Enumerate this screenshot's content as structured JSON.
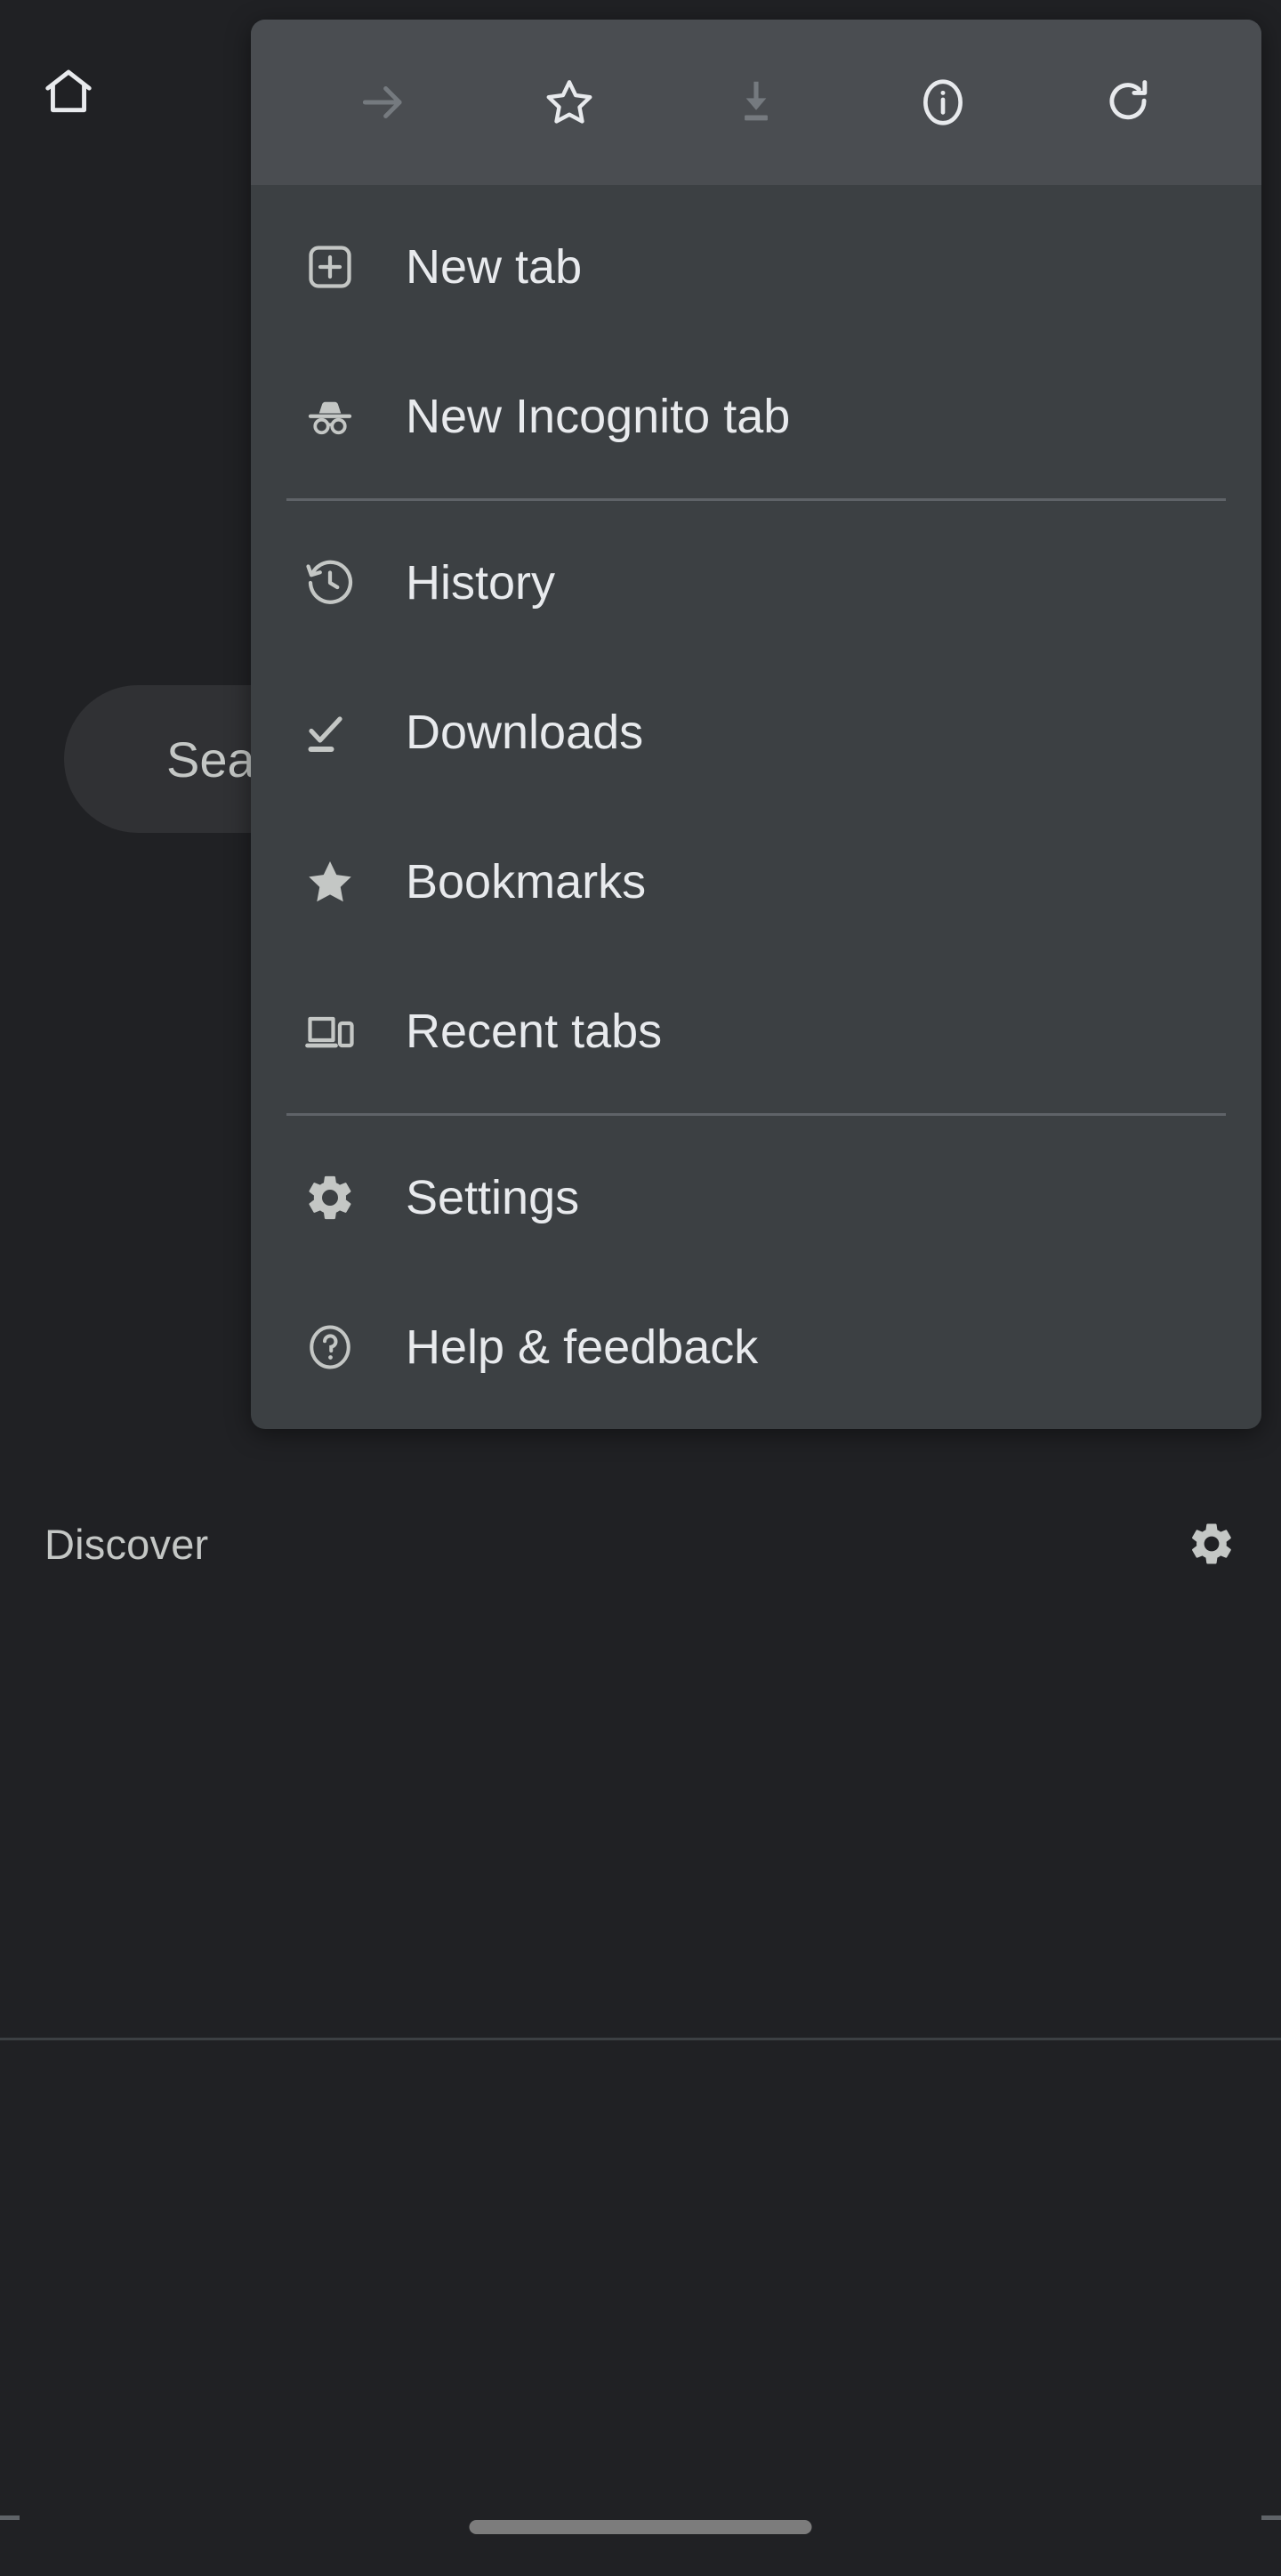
{
  "ntp": {
    "home_icon": "home-icon",
    "logo": "google-g-logo",
    "omnibox": {
      "placeholder": "Search or type web address",
      "visible_text": "Search or type "
    },
    "discover": {
      "label": "Discover",
      "settings_icon": "gear-icon"
    }
  },
  "menu": {
    "icon_row": [
      {
        "name": "forward-arrow-icon",
        "label": "Forward",
        "enabled": false
      },
      {
        "name": "star-outline-icon",
        "label": "Bookmark",
        "enabled": true
      },
      {
        "name": "download-icon",
        "label": "Download page",
        "enabled": false
      },
      {
        "name": "info-circle-icon",
        "label": "Page info",
        "enabled": true
      },
      {
        "name": "reload-icon",
        "label": "Reload",
        "enabled": true
      }
    ],
    "groups": [
      {
        "items": [
          {
            "icon": "new-tab-icon",
            "label": "New tab"
          },
          {
            "icon": "incognito-icon",
            "label": "New Incognito tab"
          }
        ]
      },
      {
        "items": [
          {
            "icon": "history-icon",
            "label": "History"
          },
          {
            "icon": "downloads-icon",
            "label": "Downloads"
          },
          {
            "icon": "star-filled-icon",
            "label": "Bookmarks"
          },
          {
            "icon": "recent-tabs-icon",
            "label": "Recent tabs"
          }
        ]
      },
      {
        "items": [
          {
            "icon": "gear-icon",
            "label": "Settings"
          },
          {
            "icon": "help-circle-icon",
            "label": "Help & feedback"
          }
        ]
      }
    ]
  },
  "colors": {
    "page_background": "#202124",
    "menu_background": "#3c4043",
    "menu_header_background": "#4a4d51",
    "text_primary": "#e8eaed",
    "text_secondary": "#c4c7c5",
    "divider": "#5f6368",
    "omnibox_background": "#303134"
  }
}
